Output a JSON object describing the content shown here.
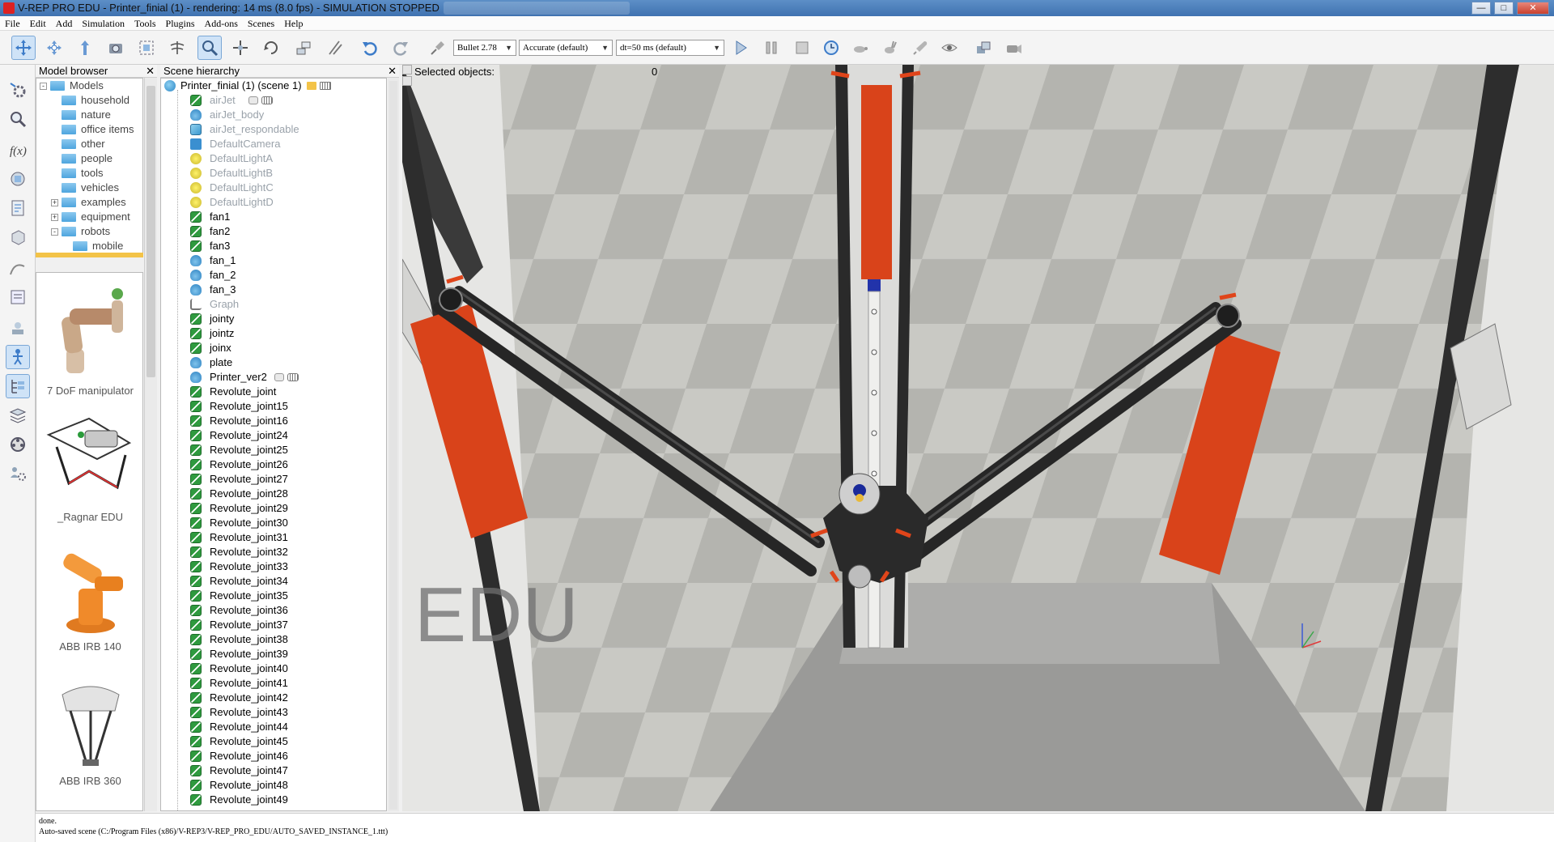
{
  "window": {
    "title": "V-REP PRO EDU - Printer_finial (1) - rendering: 14 ms (8.0 fps) - SIMULATION STOPPED"
  },
  "menu": [
    "File",
    "Edit",
    "Add",
    "Simulation",
    "Tools",
    "Plugins",
    "Add-ons",
    "Scenes",
    "Help"
  ],
  "toolbar": {
    "engine": "Bullet 2.78",
    "accuracy": "Accurate (default)",
    "dt": "dt=50 ms (default)"
  },
  "model_browser": {
    "title": "Model browser",
    "tree": [
      {
        "label": "Models",
        "level": 0,
        "expander": "-"
      },
      {
        "label": "household",
        "level": 1
      },
      {
        "label": "nature",
        "level": 1
      },
      {
        "label": "office items",
        "level": 1
      },
      {
        "label": "other",
        "level": 1
      },
      {
        "label": "people",
        "level": 1
      },
      {
        "label": "tools",
        "level": 1
      },
      {
        "label": "vehicles",
        "level": 1
      },
      {
        "label": "examples",
        "level": 1,
        "expander": "+"
      },
      {
        "label": "equipment",
        "level": 1,
        "expander": "+"
      },
      {
        "label": "robots",
        "level": 1,
        "expander": "-"
      },
      {
        "label": "mobile",
        "level": 2
      }
    ],
    "thumbnails": [
      "7 DoF manipulator",
      "_Ragnar EDU",
      "ABB IRB 140",
      "ABB IRB 360"
    ]
  },
  "scene_hierarchy": {
    "title": "Scene hierarchy",
    "root": "Printer_finial (1) (scene 1)",
    "items": [
      {
        "label": "airJet",
        "icon": "joint",
        "dim": true
      },
      {
        "label": "airJet_body",
        "icon": "shape",
        "dim": true
      },
      {
        "label": "airJet_respondable",
        "icon": "cube",
        "dim": true
      },
      {
        "label": "DefaultCamera",
        "icon": "camera",
        "dim": true
      },
      {
        "label": "DefaultLightA",
        "icon": "light",
        "dim": true
      },
      {
        "label": "DefaultLightB",
        "icon": "light",
        "dim": true
      },
      {
        "label": "DefaultLightC",
        "icon": "light",
        "dim": true
      },
      {
        "label": "DefaultLightD",
        "icon": "light",
        "dim": true
      },
      {
        "label": "fan1",
        "icon": "joint"
      },
      {
        "label": "fan2",
        "icon": "joint"
      },
      {
        "label": "fan3",
        "icon": "joint"
      },
      {
        "label": "fan_1",
        "icon": "shape"
      },
      {
        "label": "fan_2",
        "icon": "shape"
      },
      {
        "label": "fan_3",
        "icon": "shape"
      },
      {
        "label": "Graph",
        "icon": "graph",
        "dim": true
      },
      {
        "label": "jointy",
        "icon": "joint"
      },
      {
        "label": "jointz",
        "icon": "joint"
      },
      {
        "label": "joinx",
        "icon": "joint"
      },
      {
        "label": "plate",
        "icon": "shape"
      },
      {
        "label": "Printer_ver2",
        "icon": "shape"
      },
      {
        "label": "Revolute_joint",
        "icon": "joint"
      },
      {
        "label": "Revolute_joint15",
        "icon": "joint"
      },
      {
        "label": "Revolute_joint16",
        "icon": "joint"
      },
      {
        "label": "Revolute_joint24",
        "icon": "joint"
      },
      {
        "label": "Revolute_joint25",
        "icon": "joint"
      },
      {
        "label": "Revolute_joint26",
        "icon": "joint"
      },
      {
        "label": "Revolute_joint27",
        "icon": "joint"
      },
      {
        "label": "Revolute_joint28",
        "icon": "joint"
      },
      {
        "label": "Revolute_joint29",
        "icon": "joint"
      },
      {
        "label": "Revolute_joint30",
        "icon": "joint"
      },
      {
        "label": "Revolute_joint31",
        "icon": "joint"
      },
      {
        "label": "Revolute_joint32",
        "icon": "joint"
      },
      {
        "label": "Revolute_joint33",
        "icon": "joint"
      },
      {
        "label": "Revolute_joint34",
        "icon": "joint"
      },
      {
        "label": "Revolute_joint35",
        "icon": "joint"
      },
      {
        "label": "Revolute_joint36",
        "icon": "joint"
      },
      {
        "label": "Revolute_joint37",
        "icon": "joint"
      },
      {
        "label": "Revolute_joint38",
        "icon": "joint"
      },
      {
        "label": "Revolute_joint39",
        "icon": "joint"
      },
      {
        "label": "Revolute_joint40",
        "icon": "joint"
      },
      {
        "label": "Revolute_joint41",
        "icon": "joint"
      },
      {
        "label": "Revolute_joint42",
        "icon": "joint"
      },
      {
        "label": "Revolute_joint43",
        "icon": "joint"
      },
      {
        "label": "Revolute_joint44",
        "icon": "joint"
      },
      {
        "label": "Revolute_joint45",
        "icon": "joint"
      },
      {
        "label": "Revolute_joint46",
        "icon": "joint"
      },
      {
        "label": "Revolute_joint47",
        "icon": "joint"
      },
      {
        "label": "Revolute_joint48",
        "icon": "joint"
      },
      {
        "label": "Revolute_joint49",
        "icon": "joint"
      }
    ]
  },
  "viewport": {
    "selected_label": "Selected objects:",
    "selected_count": "0",
    "watermark": "EDU"
  },
  "status": {
    "line1": "done.",
    "line2": "Auto-saved scene (C:/Program Files (x86)/V-REP3/V-REP_PRO_EDU/AUTO_SAVED_INSTANCE_1.ttt)"
  },
  "colors": {
    "accent_orange": "#d9431a",
    "frame_dark": "#2c2c2c",
    "floor_light": "#cdcdc8",
    "floor_dark": "#b3b3ae"
  }
}
